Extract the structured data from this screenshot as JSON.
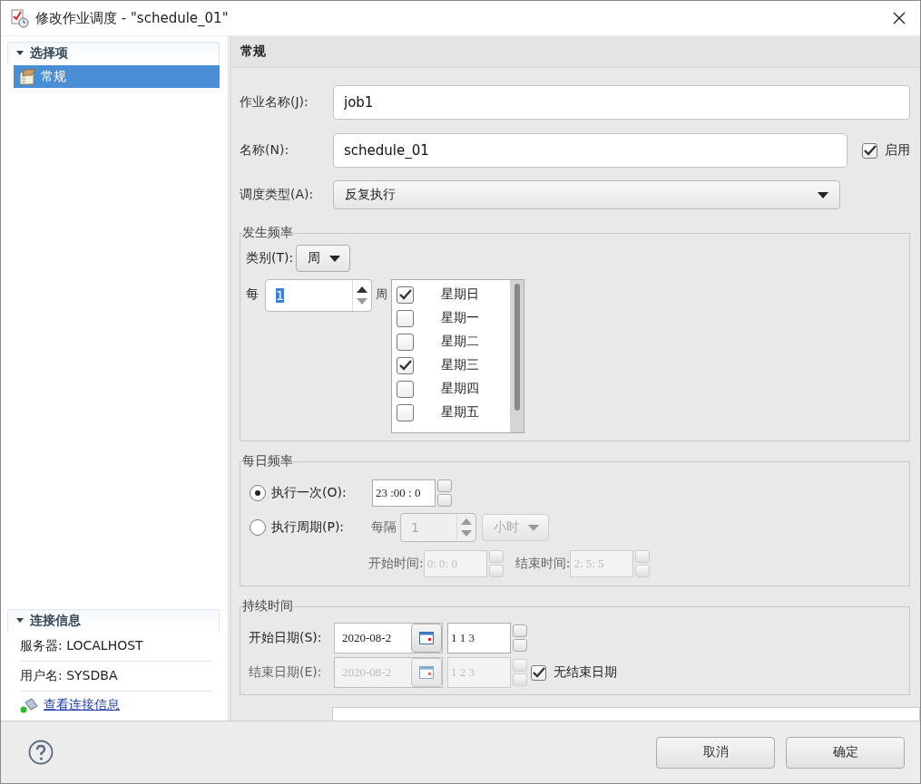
{
  "window": {
    "title": "修改作业调度 - \"schedule_01\""
  },
  "options_section": {
    "title": "选择项",
    "expanded": true,
    "items": [
      {
        "label": "常规",
        "selected": true
      }
    ]
  },
  "connection_section": {
    "title": "连接信息",
    "expanded": true,
    "rows": [
      "服务器: LOCALHOST",
      "用户名: SYSDBA"
    ],
    "link": "查看连接信息"
  },
  "panel": {
    "title": "常规"
  },
  "job_name": {
    "label": "作业名称(J):",
    "value": "job1"
  },
  "name": {
    "label": "名称(N):",
    "value": "schedule_01"
  },
  "enabled": {
    "label": "启用",
    "checked": true
  },
  "schedule_type": {
    "label": "调度类型(A):",
    "value": "反复执行"
  },
  "frequency": {
    "title": "发生频率",
    "category_label": "类别(T):",
    "category": "周",
    "every_label": "每",
    "every_value": "1",
    "unit": "周",
    "days": [
      {
        "label": "星期日",
        "checked": true
      },
      {
        "label": "星期一",
        "checked": false
      },
      {
        "label": "星期二",
        "checked": false
      },
      {
        "label": "星期三",
        "checked": true
      },
      {
        "label": "星期四",
        "checked": false
      },
      {
        "label": "星期五",
        "checked": false
      }
    ]
  },
  "daily": {
    "title": "每日频率",
    "modes": [
      {
        "label": "执行一次(O):",
        "selected": true
      },
      {
        "label": "执行周期(P):",
        "selected": false
      }
    ],
    "once_time": "23 :00 : 0",
    "interval_label": "每隔",
    "interval_value": "1",
    "interval_unit": "小时",
    "start_label": "开始时间:",
    "start_time": "0: 0: 0",
    "end_label": "结束时间:",
    "end_time": "2: 5: 5"
  },
  "duration": {
    "title": "持续时间",
    "start_label": "开始日期(S):",
    "start_date": "2020-08-2",
    "start_time": "1 1 3",
    "end_label": "结束日期(E):",
    "end_date": "2020-08-2",
    "end_time": "1 2 3",
    "no_end": {
      "label": "无结束日期",
      "checked": true
    }
  },
  "buttons": [
    "取消",
    "确定"
  ]
}
